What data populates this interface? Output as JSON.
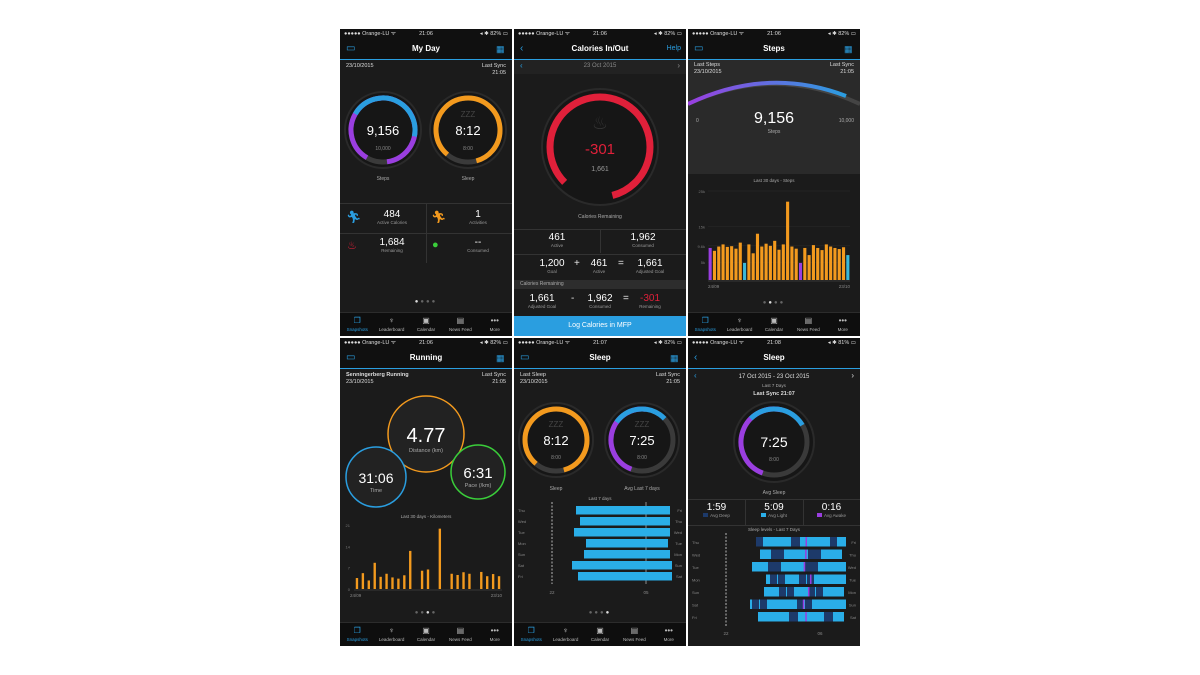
{
  "status": {
    "carrier": "●●●●● Orange-LU ᯤ",
    "battery82": "◂ ✱ 82% ▭",
    "battery81": "◂ ✱ 81% ▭"
  },
  "tabs": [
    "Snapshots",
    "Leaderboard",
    "Calendar",
    "News Feed",
    "More"
  ],
  "colors": {
    "accent": "#2a9ee0",
    "orange": "#f39a1e",
    "purple": "#9a3ee0",
    "red": "#e0203a",
    "green": "#3acd3a"
  },
  "s1": {
    "time": "21:06",
    "title": "My Day",
    "date": "23/10/2015",
    "sync_label": "Last Sync",
    "sync_time": "21:05",
    "steps": "9,156",
    "steps_goal": "10,000",
    "steps_label": "Steps",
    "sleep": "8:12",
    "sleep_goal": "8:00",
    "sleep_label": "Sleep",
    "sleep_z": "ZZZ",
    "active_cal": "484",
    "active_cal_label": "Active Calories",
    "activities": "1",
    "activities_label": "Activities",
    "remaining": "1,684",
    "remaining_label": "Remaining",
    "consumed": "--",
    "consumed_label": "Consumed"
  },
  "s2": {
    "time": "21:06",
    "title": "Calories In/Out",
    "help": "Help",
    "date": "23 Oct 2015",
    "big": "-301",
    "small": "1,661",
    "ring_label": "Calories Remaining",
    "active": "461",
    "active_label": "Active",
    "consumed": "1,962",
    "consumed_label": "Consumed",
    "goal": "1,200",
    "goal_label": "Goal",
    "plus": "+",
    "active2": "461",
    "active2_label": "Active",
    "eq": "=",
    "adj_goal": "1,661",
    "adj_goal_label": "Adjusted Goal",
    "section": "Calories Remaining",
    "adj_goal2": "1,661",
    "adj_goal2_label": "Adjusted Goal",
    "minus": "-",
    "consumed2": "1,962",
    "consumed2_label": "Consumed",
    "eq2": "=",
    "remaining": "-301",
    "remaining_label": "Remaining",
    "button": "Log Calories in MFP"
  },
  "s3": {
    "time": "21:06",
    "title": "Steps",
    "last_label": "Last Steps",
    "date": "23/10/2015",
    "sync_label": "Last Sync",
    "sync_time": "21:05",
    "steps": "9,156",
    "steps_label": "Steps",
    "min": "0",
    "max": "10,000",
    "chart_title": "Last 30 days - Steps"
  },
  "s4": {
    "time": "21:06",
    "title": "Running",
    "activity": "Senningerberg Running",
    "date": "23/10/2015",
    "sync_label": "Last Sync",
    "sync_time": "21:05",
    "distance": "4.77",
    "distance_label": "Distance (km)",
    "time_val": "31:06",
    "time_label": "Time",
    "pace": "6:31",
    "pace_label": "Pace (/km)",
    "chart_title": "Last 30 days - Kilometers"
  },
  "s5": {
    "time": "21:07",
    "title": "Sleep",
    "last_label": "Last Sleep",
    "date": "23/10/2015",
    "sync_label": "Last Sync",
    "sync_time": "21:05",
    "sleep": "8:12",
    "sleep_goal": "8:00",
    "sleep_label": "Sleep",
    "sleep_z": "ZZZ",
    "avg": "7:25",
    "avg_goal": "8:00",
    "avg_label": "Avg Last 7 days",
    "avg_z": "ZZZ",
    "chart_title": "Last 7 days",
    "xstart": "22",
    "xend": "05"
  },
  "s6": {
    "time": "21:08",
    "title": "Sleep",
    "range": "17 Oct 2015 - 23 Oct 2015",
    "sub": "Last 7 Days",
    "sync": "Last Sync 21:07",
    "avg": "7:25",
    "avg_goal": "8:00",
    "avg_label": "Avg Sleep",
    "deep": "1:59",
    "deep_label": "Avg Deep",
    "light": "5:09",
    "light_label": "Avg Light",
    "awake": "0:16",
    "awake_label": "Avg Awake",
    "chart_title": "Sleep levels - Last 7 Days",
    "xstart": "22",
    "xend": "06"
  },
  "chart_data": [
    {
      "type": "bar",
      "title": "Last 30 days - Steps",
      "xlabel": "",
      "ylabel": "",
      "yticks": [
        "25k",
        "15k",
        "9.6k",
        "5k"
      ],
      "x_start": "24/09",
      "x_end": "23/10",
      "ylim": [
        0,
        25000
      ],
      "values": [
        9000,
        8200,
        9400,
        10000,
        9300,
        9500,
        8800,
        10500,
        4800,
        10000,
        7500,
        13000,
        9400,
        10200,
        9600,
        11000,
        8500,
        10000,
        22000,
        9400,
        8800,
        4800,
        9000,
        7000,
        9800,
        9000,
        8400,
        10000,
        9400,
        9000,
        8700,
        9200,
        7000
      ],
      "highlight_colors": [
        "purple",
        "teal"
      ]
    },
    {
      "type": "bar",
      "title": "Last 30 days - Kilometers",
      "xlabel": "",
      "ylabel": "",
      "yticks": [
        "21",
        "14",
        "7",
        "0"
      ],
      "x_start": "24/09",
      "x_end": "23/10",
      "ylim": [
        0,
        21
      ],
      "values": [
        3.6,
        5.2,
        2.8,
        8.6,
        4.0,
        5.0,
        3.8,
        3.4,
        4.5,
        12.5,
        0,
        6.0,
        6.4,
        0,
        19.8,
        0,
        5.0,
        4.6,
        5.5,
        5.0,
        0,
        5.6,
        4.2,
        4.9,
        4.2
      ]
    },
    {
      "type": "bar",
      "title": "Last 7 days",
      "categories": [
        "Thu",
        "Wed",
        "Tue",
        "Mon",
        "Sun",
        "Sat",
        "Fri"
      ],
      "right_labels": [
        "Fri",
        "Thu",
        "Wed",
        "Tue",
        "Mon",
        "Sun",
        "Sat"
      ],
      "x_start": "22",
      "x_end": "05"
    },
    {
      "type": "bar",
      "title": "Sleep levels - Last 7 Days",
      "categories": [
        "Thu",
        "Wed",
        "Tue",
        "Mon",
        "Sun",
        "Sat",
        "Fri"
      ],
      "right_labels": [
        "Fri",
        "Thu",
        "Wed",
        "Tue",
        "Mon",
        "Sun",
        "Sat"
      ],
      "x_start": "22",
      "x_end": "06",
      "series": [
        {
          "name": "Avg Deep"
        },
        {
          "name": "Avg Light"
        },
        {
          "name": "Avg Awake"
        }
      ]
    }
  ]
}
